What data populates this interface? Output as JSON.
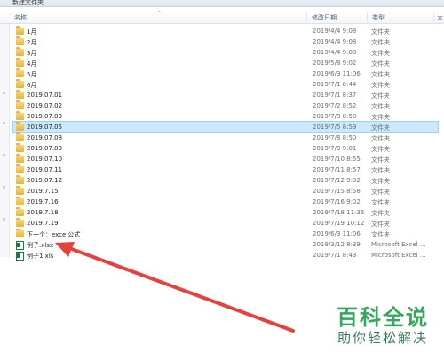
{
  "window": {
    "title": "新建文件夹"
  },
  "columns": {
    "name": "名称",
    "date": "修改日期",
    "type": "类型",
    "size": "大"
  },
  "files": [
    {
      "name": "1月",
      "date": "2019/4/4 9:08",
      "type": "文件夹",
      "icon": "folder-icon",
      "selected": false
    },
    {
      "name": "2月",
      "date": "2019/4/4 9:08",
      "type": "文件夹",
      "icon": "folder-icon",
      "selected": false
    },
    {
      "name": "3月",
      "date": "2019/4/4 9:08",
      "type": "文件夹",
      "icon": "folder-icon",
      "selected": false
    },
    {
      "name": "4月",
      "date": "2019/5/8 9:02",
      "type": "文件夹",
      "icon": "folder-icon",
      "selected": false
    },
    {
      "name": "5月",
      "date": "2019/6/3 11:06",
      "type": "文件夹",
      "icon": "folder-icon",
      "selected": false
    },
    {
      "name": "6月",
      "date": "2019/7/1 8:44",
      "type": "文件夹",
      "icon": "folder-icon",
      "selected": false
    },
    {
      "name": "2019.07.01",
      "date": "2019/7/1 8:37",
      "type": "文件夹",
      "icon": "folder-icon",
      "selected": false
    },
    {
      "name": "2019.07.02",
      "date": "2019/7/2 8:52",
      "type": "文件夹",
      "icon": "folder-icon",
      "selected": false
    },
    {
      "name": "2019.07.03",
      "date": "2019/7/3 8:58",
      "type": "文件夹",
      "icon": "folder-icon",
      "selected": false
    },
    {
      "name": "2019.07.05",
      "date": "2019/7/5 8:59",
      "type": "文件夹",
      "icon": "folder-icon",
      "selected": true
    },
    {
      "name": "2019.07.08",
      "date": "2019/7/8 8:50",
      "type": "文件夹",
      "icon": "folder-icon",
      "selected": false
    },
    {
      "name": "2019.07.09",
      "date": "2019/7/9 9:01",
      "type": "文件夹",
      "icon": "folder-icon",
      "selected": false
    },
    {
      "name": "2019.07.10",
      "date": "2019/7/10 8:55",
      "type": "文件夹",
      "icon": "folder-icon",
      "selected": false
    },
    {
      "name": "2019.07.11",
      "date": "2019/7/11 8:57",
      "type": "文件夹",
      "icon": "folder-icon",
      "selected": false
    },
    {
      "name": "2019.07.12",
      "date": "2019/7/12 9:02",
      "type": "文件夹",
      "icon": "folder-icon",
      "selected": false
    },
    {
      "name": "2019.7.15",
      "date": "2019/7/15 8:58",
      "type": "文件夹",
      "icon": "folder-icon",
      "selected": false
    },
    {
      "name": "2019.7.16",
      "date": "2019/7/16 9:02",
      "type": "文件夹",
      "icon": "folder-icon",
      "selected": false
    },
    {
      "name": "2019.7.18",
      "date": "2019/7/18 11:36",
      "type": "文件夹",
      "icon": "folder-icon",
      "selected": false
    },
    {
      "name": "2019.7.19",
      "date": "2019/7/19 10:12",
      "type": "文件夹",
      "icon": "folder-icon",
      "selected": false
    },
    {
      "name": "下一个：excel公式",
      "date": "2019/6/3 11:06",
      "type": "文件夹",
      "icon": "folder-icon",
      "selected": false
    },
    {
      "name": "例子.xlsx",
      "date": "2019/3/12 8:39",
      "type": "Microsoft Excel ...",
      "icon": "excel-file-icon",
      "selected": false
    },
    {
      "name": "例子1.xls",
      "date": "2019/7/1 8:43",
      "type": "Microsoft Excel ...",
      "icon": "excel-file-icon",
      "selected": false
    }
  ],
  "watermark": {
    "title": "百科全说",
    "subtitle": "助你轻松解决"
  },
  "colors": {
    "selection": "#cce8ff",
    "selection_border": "#99d1ff",
    "folder": "#f2c550",
    "excel": "#1d7a3e",
    "arrow": "#e8413c",
    "watermark": "#34a85a"
  }
}
